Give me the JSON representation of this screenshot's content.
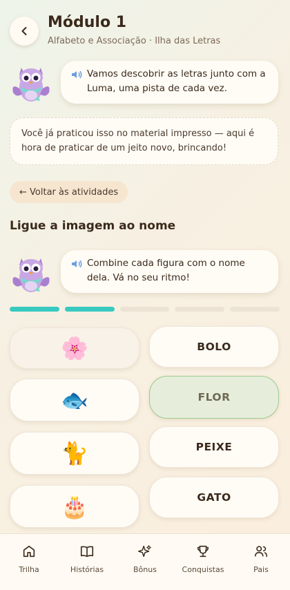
{
  "header": {
    "title": "Módulo 1",
    "subtitle": "Alfabeto e Associação · Ilha das Letras",
    "back_icon": "chevron-left-icon"
  },
  "intro_bubble": {
    "text": "Vamos descobrir as letras junto com a Luma, uma pista de cada vez.",
    "icon": "speaker-icon"
  },
  "notice": {
    "text": "Você já praticou isso no material impresso — aqui é hora de praticar de um jeito novo, brincando!"
  },
  "back_link": {
    "label": "← Voltar às atividades"
  },
  "activity": {
    "title": "Ligue a imagem ao nome",
    "instruction": "Combine cada figura com o nome dela. Vá no seu ritmo!",
    "progress": {
      "total_steps": 5,
      "completed": 2
    },
    "images": [
      {
        "emoji": "🌸",
        "name": "flower-image",
        "state": "matched"
      },
      {
        "emoji": "🐟",
        "name": "fish-image",
        "state": "default"
      },
      {
        "emoji": "🐈",
        "name": "cat-image",
        "state": "default"
      },
      {
        "emoji": "🎂",
        "name": "cake-image",
        "state": "default"
      }
    ],
    "words": [
      {
        "text": "BOLO",
        "state": "default"
      },
      {
        "text": "FLOR",
        "state": "matched"
      },
      {
        "text": "PEIXE",
        "state": "default"
      },
      {
        "text": "GATO",
        "state": "default"
      }
    ]
  },
  "bottom_nav": [
    {
      "label": "Trilha",
      "icon": "home-icon"
    },
    {
      "label": "Histórias",
      "icon": "book-icon"
    },
    {
      "label": "Bônus",
      "icon": "sparkles-icon"
    },
    {
      "label": "Conquistas",
      "icon": "trophy-icon"
    },
    {
      "label": "Pais",
      "icon": "users-icon"
    }
  ],
  "colors": {
    "accent": "#38c9c0",
    "matched_bg": "#e6eedb",
    "matched_border": "#9cc98d",
    "text": "#3b2a1c"
  }
}
